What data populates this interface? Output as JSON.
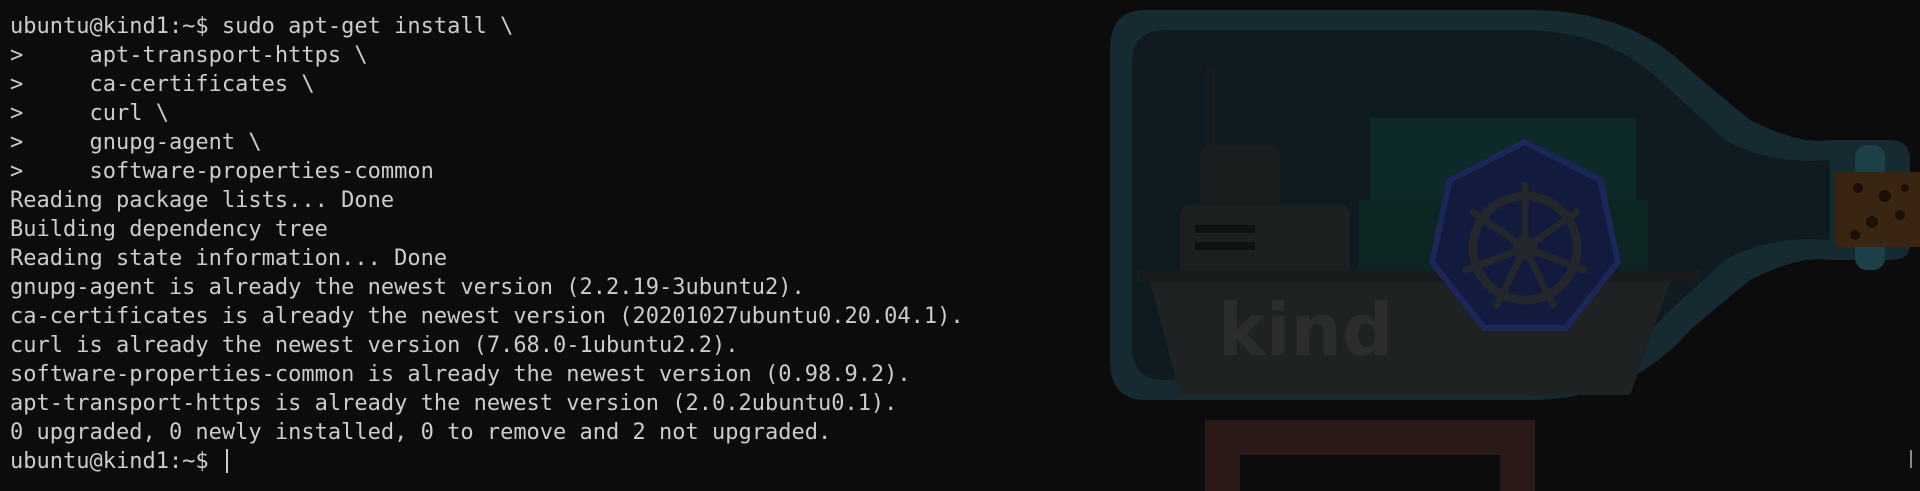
{
  "terminal": {
    "lines": [
      "ubuntu@kind1:~$ sudo apt-get install \\",
      ">     apt-transport-https \\",
      ">     ca-certificates \\",
      ">     curl \\",
      ">     gnupg-agent \\",
      ">     software-properties-common",
      "Reading package lists... Done",
      "Building dependency tree",
      "Reading state information... Done",
      "gnupg-agent is already the newest version (2.2.19-3ubuntu2).",
      "ca-certificates is already the newest version (20201027ubuntu0.20.04.1).",
      "curl is already the newest version (7.68.0-1ubuntu2.2).",
      "software-properties-common is already the newest version (0.98.9.2).",
      "apt-transport-https is already the newest version (2.0.2ubuntu0.1).",
      "0 upgraded, 0 newly installed, 0 to remove and 2 not upgraded."
    ],
    "prompt": "ubuntu@kind1:~$ ",
    "text_color": "#cccccc",
    "background_color": "#0c0c0c"
  },
  "background": {
    "logo_text": "kind",
    "icon": "kind-bottle-logo"
  }
}
